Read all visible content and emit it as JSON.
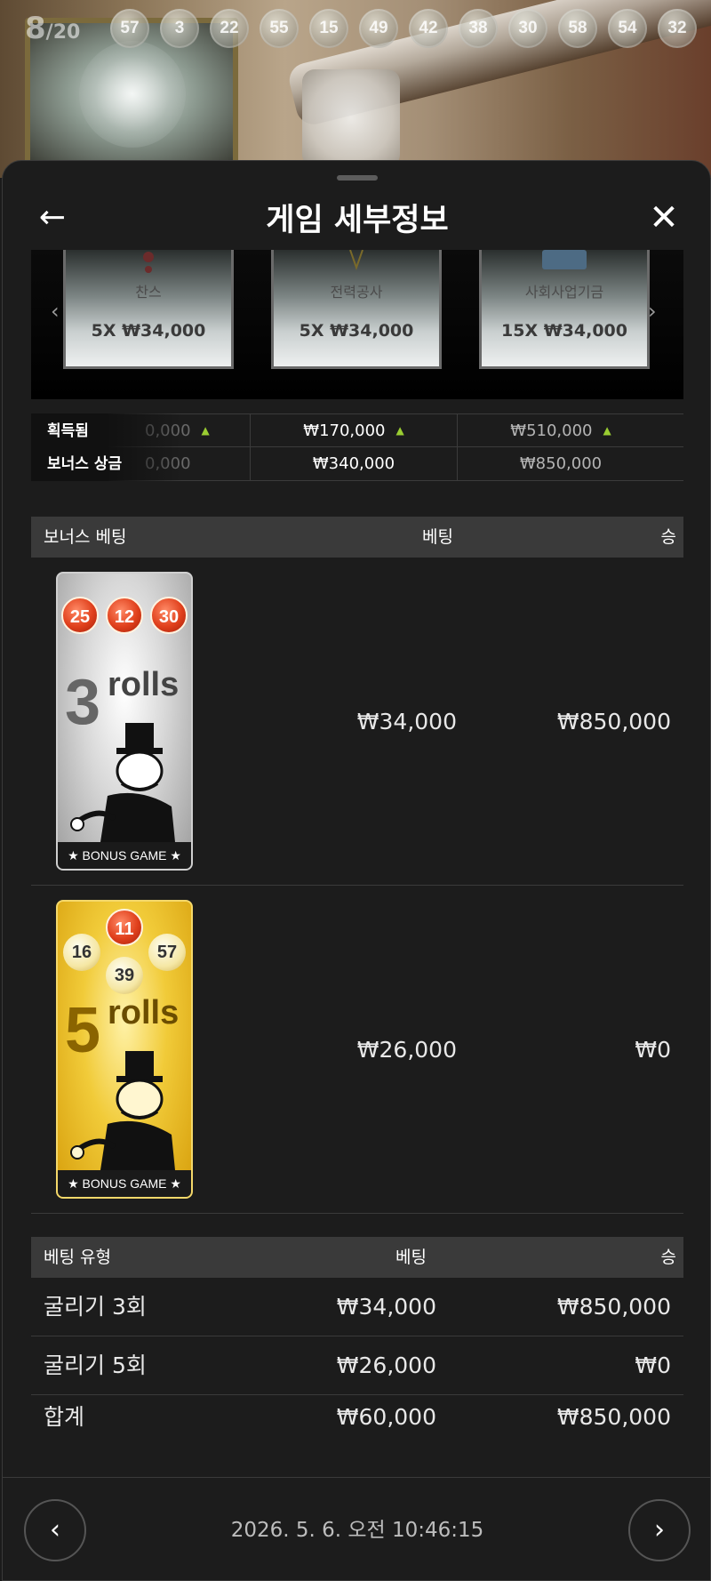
{
  "stream": {
    "round": {
      "current": "8",
      "total": "/20"
    },
    "drawn_balls": [
      "57",
      "3",
      "22",
      "55",
      "15",
      "49",
      "42",
      "38",
      "30",
      "58",
      "54",
      "32"
    ]
  },
  "header": {
    "title": "게임 세부정보"
  },
  "carousel": {
    "cards": [
      {
        "name": "찬스",
        "multiplier": "5X ₩34,000"
      },
      {
        "name": "전력공사",
        "multiplier": "5X ₩34,000"
      },
      {
        "name": "사회사업기금",
        "multiplier": "15X ₩34,000"
      }
    ]
  },
  "summary_rows": {
    "earned": {
      "label": "획득됨",
      "values": [
        "0,000",
        "₩170,000",
        "₩510,000"
      ]
    },
    "bonus_prize": {
      "label": "보너스 상금",
      "values": [
        "0,000",
        "₩340,000",
        "₩850,000"
      ]
    }
  },
  "bonus_table": {
    "headers": {
      "col1": "보너스 베팅",
      "col2": "베팅",
      "col3": "승"
    },
    "rows": [
      {
        "card": {
          "rolls_number": "3",
          "rolls_word": "rolls",
          "balls": [
            "25",
            "12",
            "30"
          ],
          "footer": "★ BONUS GAME ★"
        },
        "bet": "₩34,000",
        "win": "₩850,000"
      },
      {
        "card": {
          "rolls_number": "5",
          "rolls_word": "rolls",
          "balls": [
            "11",
            "16",
            "57",
            "39"
          ],
          "footer": "★ BONUS GAME ★"
        },
        "bet": "₩26,000",
        "win": "₩0"
      }
    ]
  },
  "bet_type_table": {
    "headers": {
      "col1": "베팅 유형",
      "col2": "베팅",
      "col3": "승"
    },
    "rows": [
      {
        "type": "굴리기 3회",
        "bet": "₩34,000",
        "win": "₩850,000"
      },
      {
        "type": "굴리기 5회",
        "bet": "₩26,000",
        "win": "₩0"
      }
    ],
    "total": {
      "type": "합계",
      "bet": "₩60,000",
      "win": "₩850,000"
    }
  },
  "footer": {
    "timestamp": "2026. 5. 6. 오전 10:46:15"
  },
  "colors": {
    "accent_up": "#9acd32",
    "sheet_bg": "#1c1c1c",
    "header_row_bg": "#3a3a3a"
  }
}
